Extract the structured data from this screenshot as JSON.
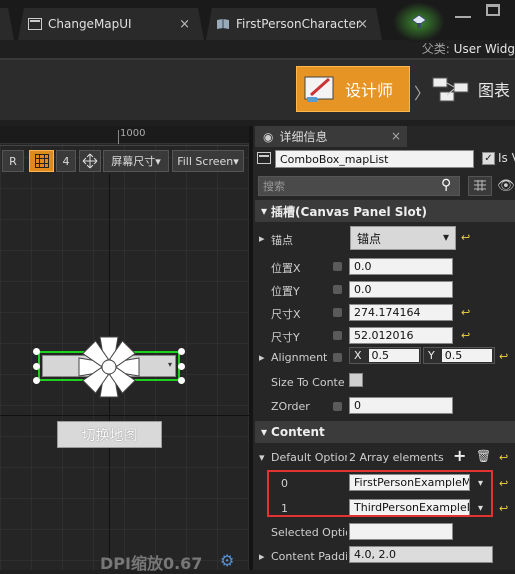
{
  "tabs": [
    {
      "label": "ChangeMapUI",
      "close": "×"
    },
    {
      "label": "FirstPersonCharacter",
      "close": "×"
    }
  ],
  "parent": {
    "label": "父类:",
    "value": "User Widg"
  },
  "modes": {
    "designer": "设计师",
    "graph": "图表"
  },
  "viewport": {
    "ruler_tick": "1000",
    "buttons": {
      "r": "R",
      "four": "4",
      "screen_size": "屏幕尺寸",
      "fill_screen": "Fill Screen"
    },
    "map_button": "切换地图",
    "dpi": "DPI缩放0.67"
  },
  "details": {
    "tab_title": "详细信息",
    "widget_name": "ComboBox_mapList",
    "is_variable": "Is V",
    "search_placeholder": "搜索",
    "slot_section": "插槽(Canvas Panel Slot)",
    "anchor_label": "锚点",
    "anchor_value": "锚点",
    "pos_x_label": "位置X",
    "pos_x": "0.0",
    "pos_y_label": "位置Y",
    "pos_y": "0.0",
    "size_x_label": "尺寸X",
    "size_x": "274.174164",
    "size_y_label": "尺寸Y",
    "size_y": "52.012016",
    "alignment_label": "Alignment",
    "align_x_label": "X",
    "align_x": "0.5",
    "align_y_label": "Y",
    "align_y": "0.5",
    "size_to_content": "Size To Content",
    "zorder_label": "ZOrder",
    "zorder": "0",
    "content_section": "Content",
    "default_options_label": "Default Options",
    "array_count": "2 Array elements",
    "options": [
      {
        "index": "0",
        "value": "FirstPersonExampleMa"
      },
      {
        "index": "1",
        "value": "ThirdPersonExampleM"
      }
    ],
    "selected_option_label": "Selected Optio",
    "content_padding_label": "Content Paddin",
    "content_padding": "4.0, 2.0"
  }
}
